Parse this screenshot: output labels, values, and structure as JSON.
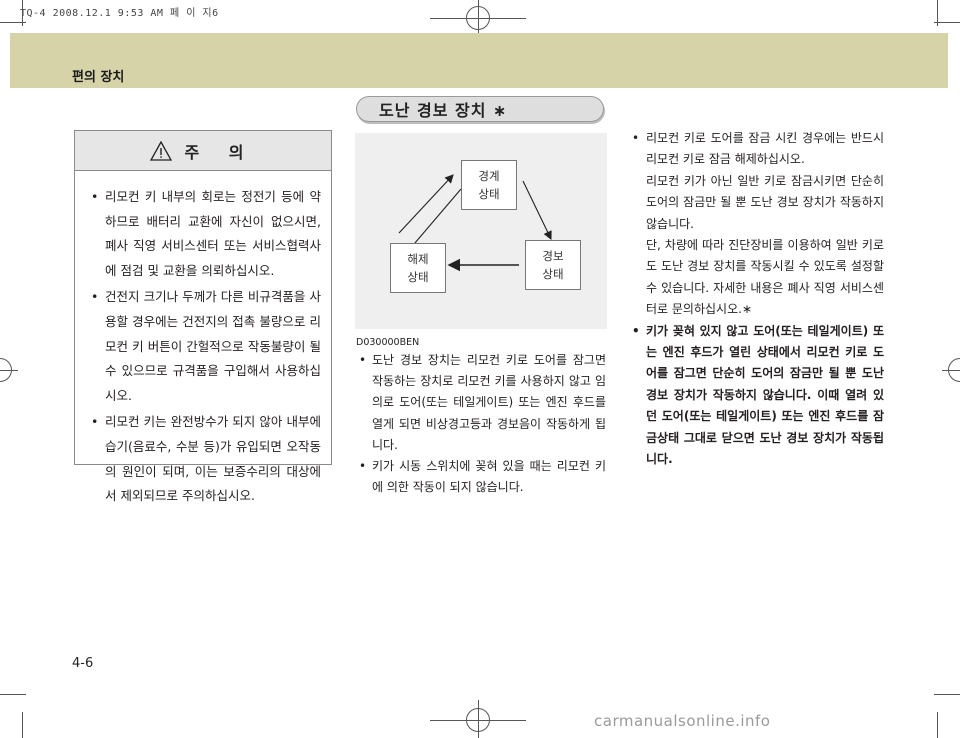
{
  "print_header": "TQ-4 2008.12.1 9:53 AM 페 이 지6",
  "section_title": "편의 장치",
  "caution": {
    "title": "주  의",
    "items": [
      "리모컨 키 내부의 회로는 정전기 등에 약하므로 배터리 교환에 자신이 없으시면, 폐사 직영 서비스센터 또는 서비스협력사에 점검 및 교환을 의뢰하십시오.",
      "건전지 크기나 두께가 다른 비규격품을 사용할 경우에는 건전지의 접촉 불량으로 리모컨 키 버튼이 간헐적으로 작동불량이 될 수 있으므로 규격품을 구입해서 사용하십시오.",
      "리모컨 키는 완전방수가 되지 않아 내부에 습기(음료수, 수분 등)가 유입되면 오작동의 원인이 되며, 이는 보증수리의 대상에서 제외되므로 주의하십시오."
    ]
  },
  "feature_title": "도난 경보 장치 ∗",
  "diagram": {
    "states": {
      "armed": [
        "경계",
        "상태"
      ],
      "alarm": [
        "경보",
        "상태"
      ],
      "disarmed": [
        "해제",
        "상태"
      ]
    }
  },
  "code": "D030000BEN",
  "center_items": [
    "도난 경보 장치는 리모컨 키로 도어를 잠그면 작동하는 장치로 리모컨 키를 사용하지 않고 임의로 도어(또는 테일게이트) 또는 엔진 후드를 열게 되면 비상경고등과 경보음이 작동하게 됩니다.",
    "키가 시동 스위치에 꽂혀 있을 때는 리모컨 키에 의한 작동이 되지 않습니다."
  ],
  "right_items": [
    {
      "paras": [
        "리모컨 키로 도어를 잠금 시킨 경우에는 반드시 리모컨 키로 잠금 해제하십시오.",
        "리모컨 키가 아닌 일반 키로 잠금시키면 단순히 도어의 잠금만 될 뿐 도난 경보 장치가 작동하지 않습니다.",
        "단, 차량에 따라 진단장비를 이용하여 일반 키로도 도난 경보 장치를 작동시킬 수 있도록 설정할 수 있습니다. 자세한 내용은 폐사 직영 서비스센터로 문의하십시오.∗"
      ]
    },
    {
      "paras": [
        "키가 꽂혀 있지 않고 도어(또는 테일게이트) 또는 엔진 후드가 열린 상태에서 리모컨 키로 도어를 잠그면 단순히 도어의 잠금만 될 뿐 도난 경보 장치가 작동하지 않습니다. 이때 열려 있던 도어(또는 테일게이트) 또는 엔진 후드를 잠금상태 그대로 닫으면 도난 경보 장치가 작동됩니다."
      ]
    }
  ],
  "page_number": "4-6",
  "watermark": "carmanualsonline.info",
  "colors": {
    "header_band": "#d6d3a8",
    "diagram_bg": "#efefef",
    "caution_head": "#e6e6e6"
  }
}
